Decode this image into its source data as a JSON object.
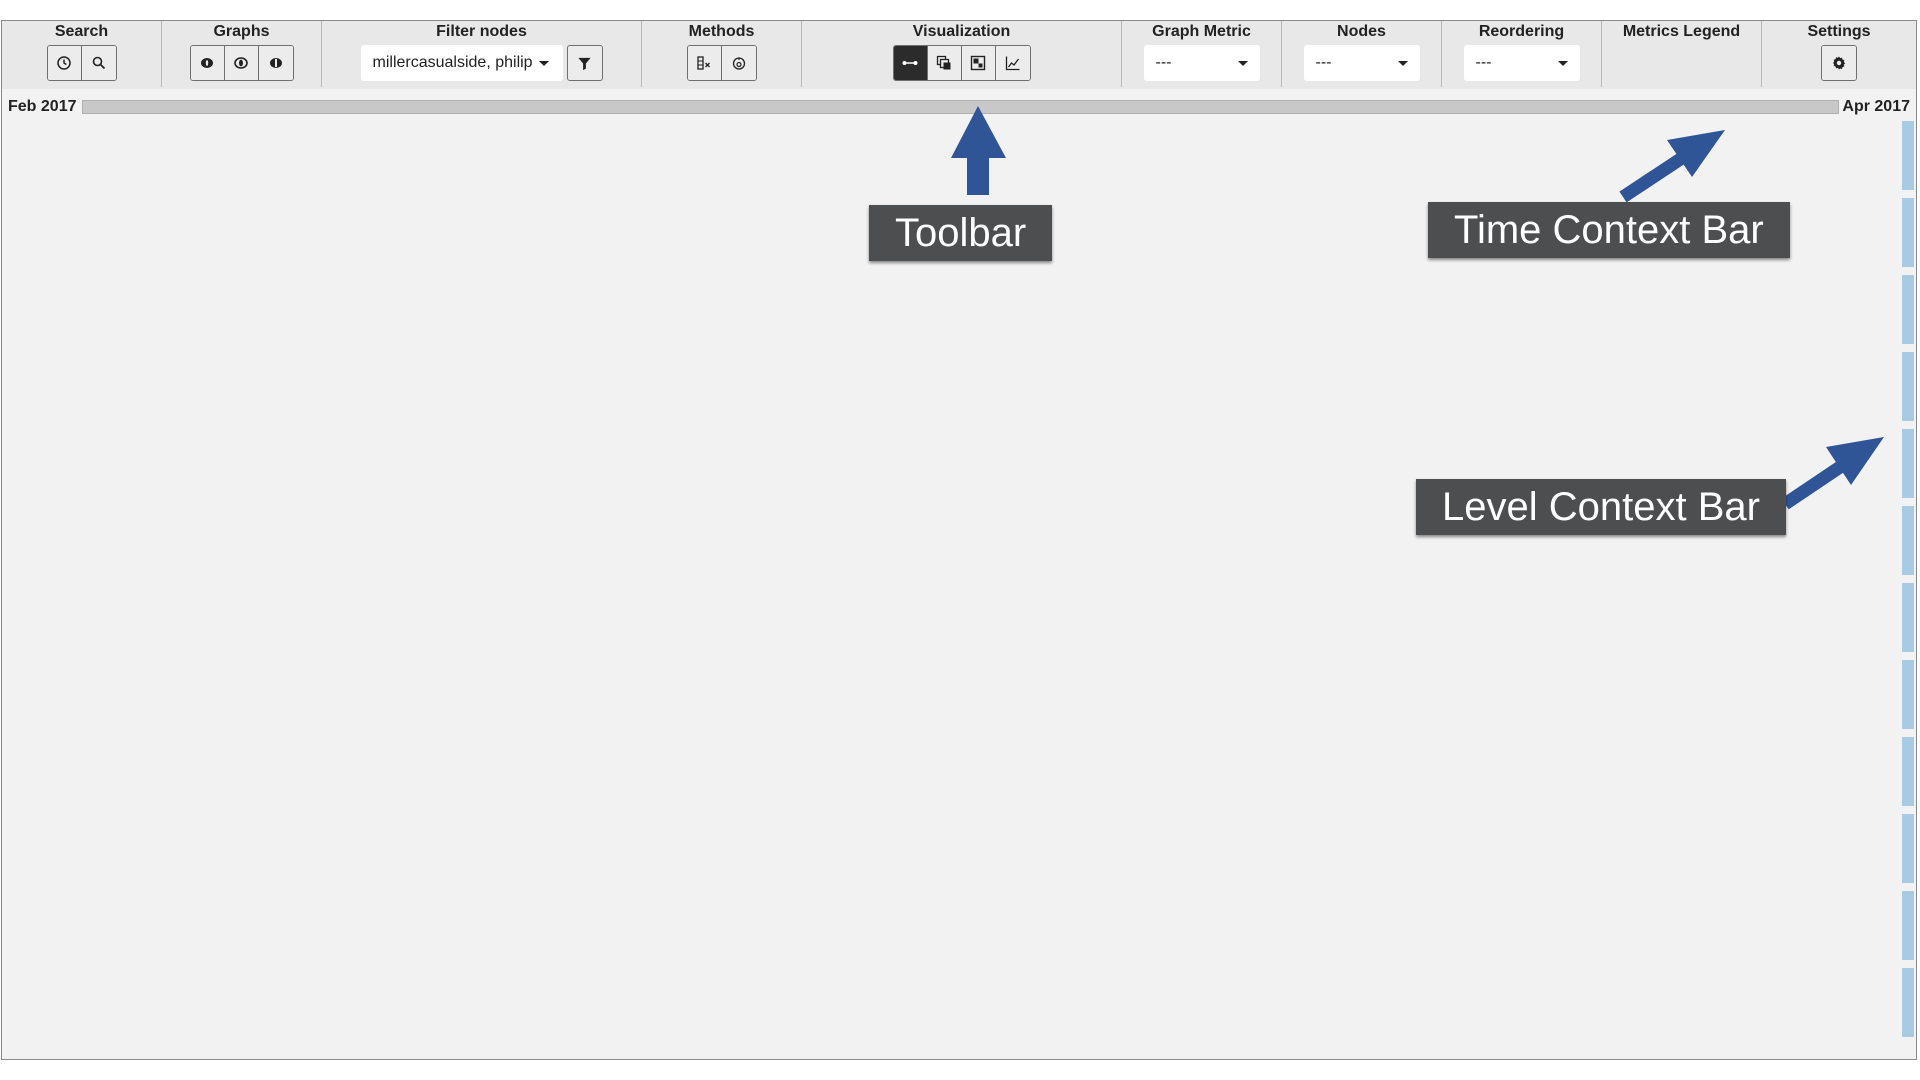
{
  "toolbar": {
    "search": {
      "label": "Search",
      "icons": [
        "clock-icon",
        "magnifier-icon"
      ]
    },
    "graphs": {
      "label": "Graphs",
      "icons": [
        "graph-view-1-icon",
        "graph-view-2-icon",
        "graph-view-3-icon"
      ]
    },
    "filter_nodes": {
      "label": "Filter nodes",
      "value": "millercasualside, philip",
      "filter_icon": "funnel-icon"
    },
    "methods": {
      "label": "Methods",
      "icons": [
        "method-1-icon",
        "method-2-icon"
      ]
    },
    "visualization": {
      "label": "Visualization",
      "icons": [
        "node-link-icon",
        "layers-icon",
        "matrix-icon",
        "line-chart-icon"
      ],
      "active_index": 0
    },
    "graph_metric": {
      "label": "Graph Metric",
      "value": "---"
    },
    "nodes": {
      "label": "Nodes",
      "value": "---"
    },
    "reordering": {
      "label": "Reordering",
      "value": "---"
    },
    "metrics_legend": {
      "label": "Metrics Legend"
    },
    "settings": {
      "label": "Settings",
      "icon": "gear-icon"
    }
  },
  "time_context": {
    "start": "Feb 2017",
    "end": "Apr 2017"
  },
  "level_context": {
    "segments": 12
  },
  "annotations": {
    "toolbar": "Toolbar",
    "time_context_bar": "Time Context Bar",
    "level_context_bar": "Level Context Bar"
  },
  "colors": {
    "arrow": "#2f5597",
    "callout_bg": "#4d4e50",
    "level_bar": "#a7cbe2",
    "time_bar": "#c8c8c8",
    "active_button": "#2b2b2b"
  }
}
